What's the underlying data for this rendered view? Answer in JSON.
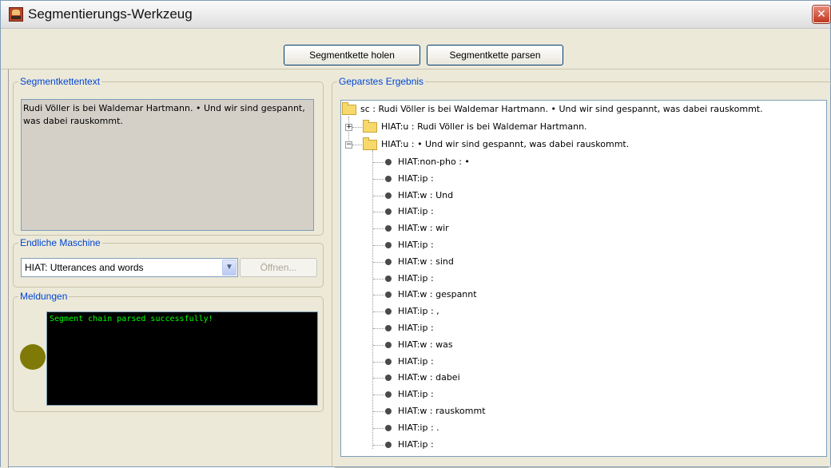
{
  "window": {
    "title": "Segmentierungs-Werkzeug",
    "close_glyph": "✕"
  },
  "toolbar": {
    "get_chain_label": "Segmentkette holen",
    "parse_chain_label": "Segmentkette parsen"
  },
  "segment_text": {
    "legend": "Segmentkettentext",
    "value": "Rudi Völler is bei Waldemar Hartmann. • Und wir sind gespannt, was dabei rauskommt."
  },
  "machine": {
    "legend": "Endliche Maschine",
    "selected": "HIAT: Utterances and words",
    "open_label": "Öffnen..."
  },
  "messages": {
    "legend": "Meldungen",
    "console_text": "Segment chain parsed successfully!",
    "status_color": "#7f7a08"
  },
  "result": {
    "legend": "Geparstes Ergebnis",
    "root": "sc : Rudi Völler is bei Waldemar Hartmann. • Und wir sind gespannt, was dabei rauskommt.",
    "utterance_1": "HIAT:u : Rudi Völler is bei Waldemar Hartmann.",
    "utterance_2": "HIAT:u : • Und wir sind gespannt, was dabei rauskommt.",
    "children": [
      "HIAT:non-pho : •",
      "HIAT:ip :",
      "HIAT:w : Und",
      "HIAT:ip :",
      "HIAT:w : wir",
      "HIAT:ip :",
      "HIAT:w : sind",
      "HIAT:ip :",
      "HIAT:w : gespannt",
      "HIAT:ip : ,",
      "HIAT:ip :",
      "HIAT:w : was",
      "HIAT:ip :",
      "HIAT:w : dabei",
      "HIAT:ip :",
      "HIAT:w : rauskommt",
      "HIAT:ip : .",
      "HIAT:ip :"
    ]
  }
}
